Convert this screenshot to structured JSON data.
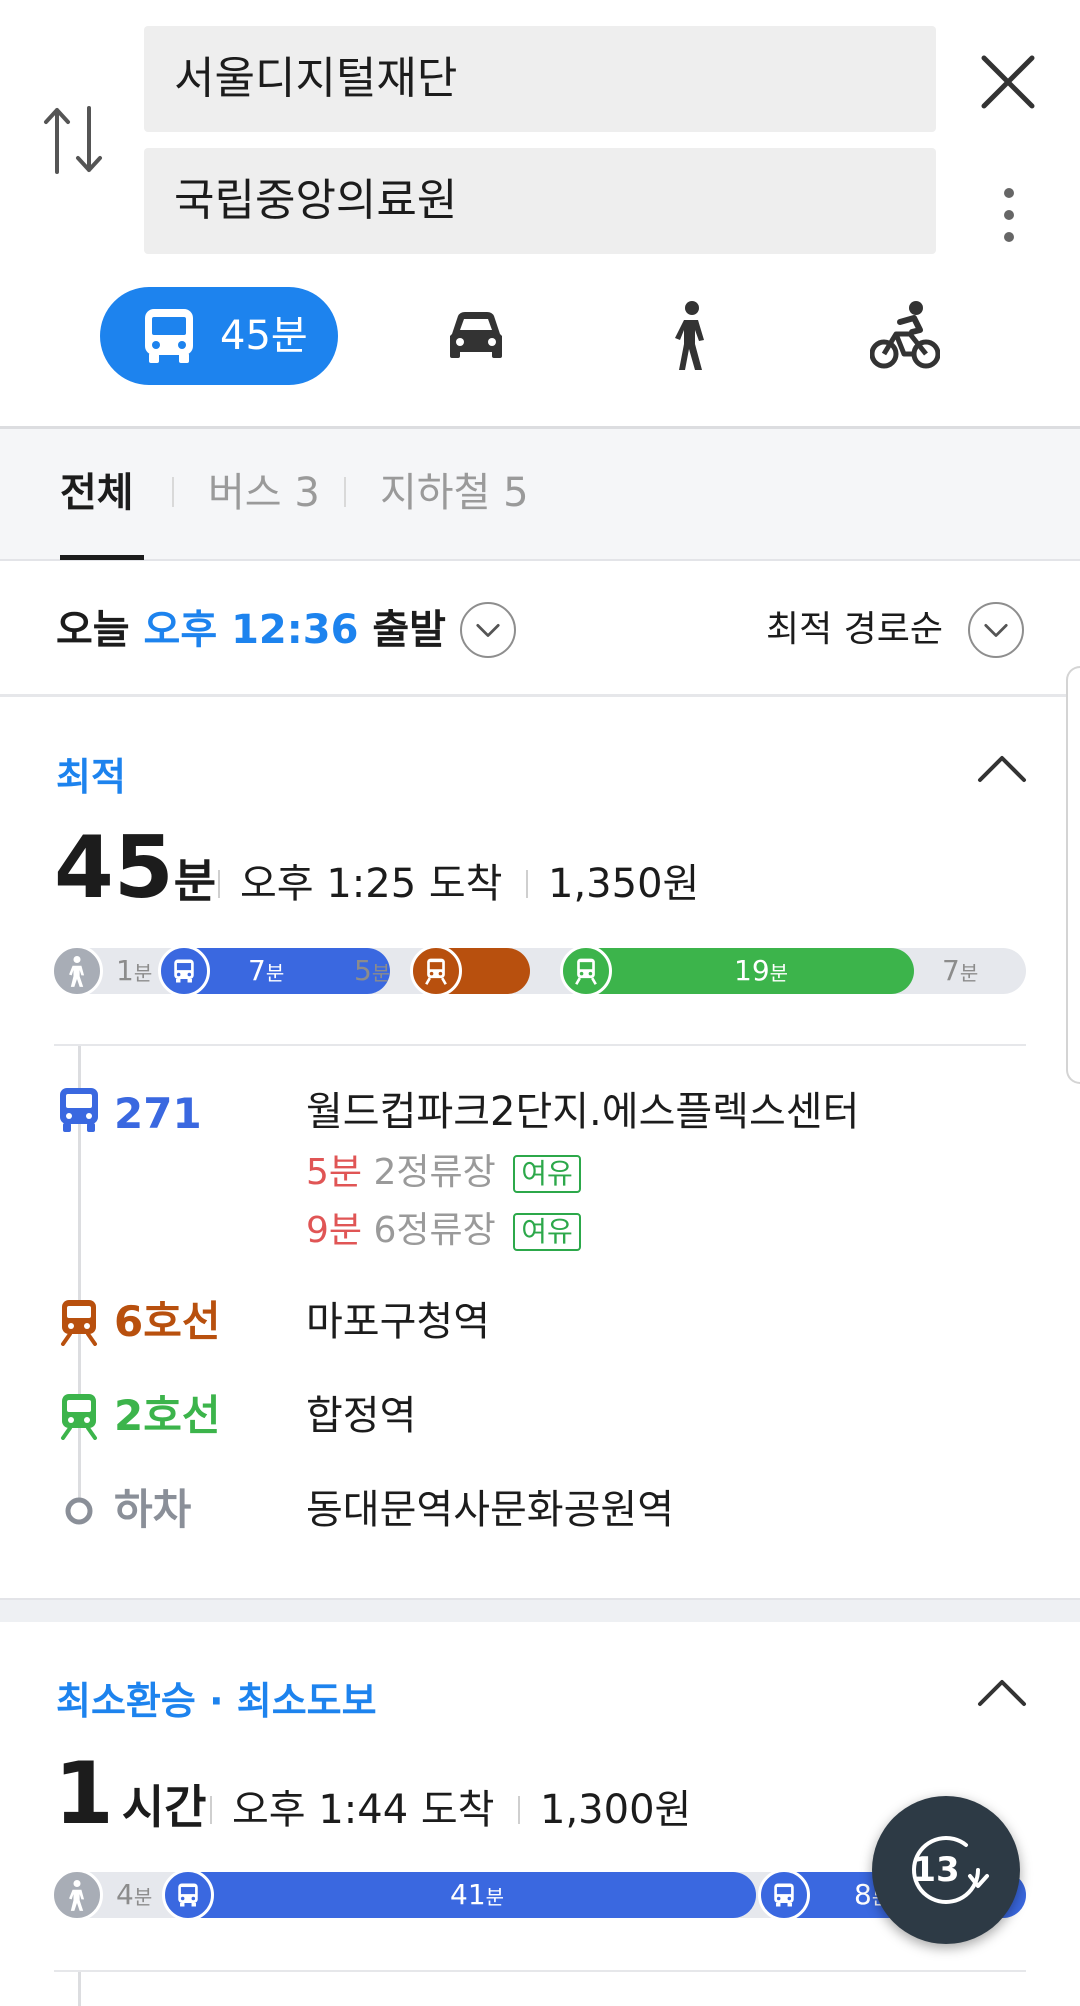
{
  "search": {
    "origin": "서울디지털재단",
    "destination": "국립중앙의료원"
  },
  "modes": {
    "transit_time": "45분"
  },
  "tabs": {
    "all": "전체",
    "bus": "버스 3",
    "subway": "지하철 5"
  },
  "depart": {
    "day": "오늘",
    "time": "오후 12:36",
    "suffix": "출발",
    "sort": "최적 경로순"
  },
  "route1": {
    "tag": "최적",
    "duration_num": "45",
    "duration_unit": "분",
    "arrival": "오후 1:25 도착",
    "fare": "1,350원",
    "timeline": {
      "walk1": "1",
      "bus": "7",
      "walk2": "5",
      "subway2": "19",
      "walk3": "7",
      "unit": "분"
    },
    "steps": {
      "bus_label": "271",
      "bus_stop": "월드컵파크2단지.에스플렉스센터",
      "arrival1_min": "5분",
      "arrival1_stops": "2정류장",
      "arrival1_status": "여유",
      "arrival2_min": "9분",
      "arrival2_stops": "6정류장",
      "arrival2_status": "여유",
      "line6_label": "6호선",
      "line6_station": "마포구청역",
      "line2_label": "2호선",
      "line2_station": "합정역",
      "alight_label": "하차",
      "alight_station": "동대문역사문화공원역"
    }
  },
  "route2": {
    "tag": "최소환승 · 최소도보",
    "duration_num": "1",
    "duration_unit": "시간",
    "arrival": "오후 1:44 도착",
    "fare": "1,300원",
    "timeline": {
      "walk1": "4",
      "bus1": "41",
      "bus2": "8",
      "unit": "분"
    }
  },
  "fab": {
    "count": "13"
  },
  "colors": {
    "accent": "#1d83ee",
    "bus": "#3a68e0",
    "line6": "#b8500e",
    "line2": "#3cb44b",
    "arrival_red": "#e05555"
  }
}
